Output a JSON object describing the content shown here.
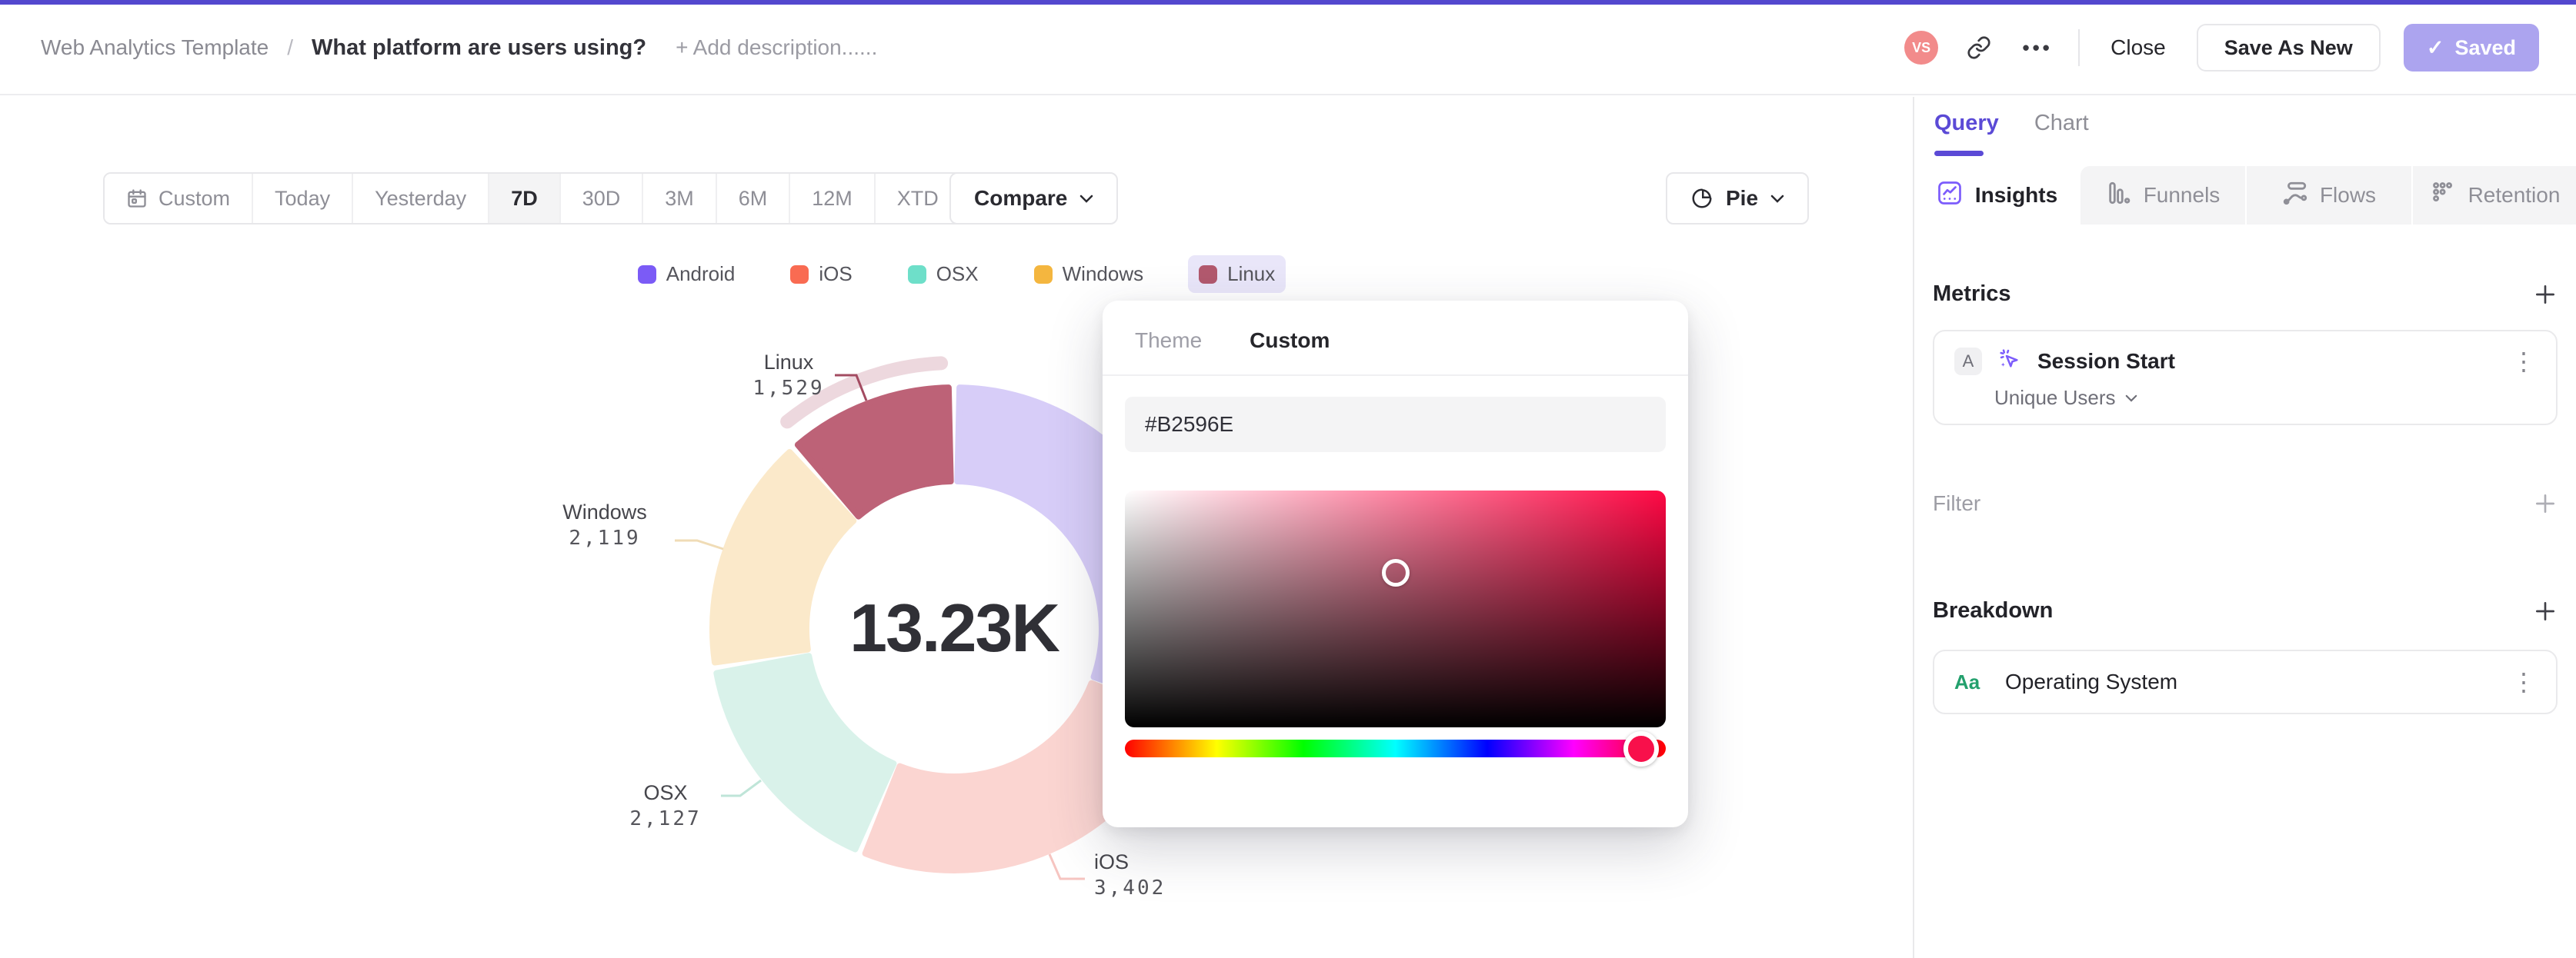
{
  "topbar": {
    "breadcrumb_root": "Web Analytics Template",
    "separator": "/",
    "title": "What platform are users using?",
    "add_description": "+ Add description......",
    "avatar_initials": "VS",
    "close_label": "Close",
    "save_as_new_label": "Save As New",
    "saved_label": "Saved",
    "accent_color": "#5348ce",
    "avatar_color": "#f28b8b",
    "saved_button_color": "#aca4ef"
  },
  "toolbar": {
    "ranges": [
      {
        "label": "Custom",
        "active": false
      },
      {
        "label": "Today",
        "active": false
      },
      {
        "label": "Yesterday",
        "active": false
      },
      {
        "label": "7D",
        "active": true
      },
      {
        "label": "30D",
        "active": false
      },
      {
        "label": "3M",
        "active": false
      },
      {
        "label": "6M",
        "active": false
      },
      {
        "label": "12M",
        "active": false
      },
      {
        "label": "XTD",
        "active": false
      }
    ],
    "compare_label": "Compare",
    "chart_type_label": "Pie"
  },
  "legend": {
    "items": [
      {
        "label": "Android",
        "color": "#7b5bf6",
        "selected": false
      },
      {
        "label": "iOS",
        "color": "#f96b52",
        "selected": false
      },
      {
        "label": "OSX",
        "color": "#6edfc9",
        "selected": false
      },
      {
        "label": "Windows",
        "color": "#f4b63f",
        "selected": false
      },
      {
        "label": "Linux",
        "color": "#b2596e",
        "selected": true
      }
    ],
    "selected_bg": "#e9e6f9"
  },
  "chart_data": {
    "type": "pie",
    "center_total": "13.23K",
    "categories": [
      "Android",
      "iOS",
      "OSX",
      "Windows",
      "Linux"
    ],
    "values": [
      4053,
      3402,
      2127,
      2119,
      1529
    ],
    "value_labels": [
      "",
      "3,402",
      "2,127",
      "2,119",
      "1,529"
    ],
    "slice_colors": [
      "#d7cdf8",
      "#fbd5d1",
      "#d9f2ea",
      "#fbe9ca",
      "#bd6277"
    ],
    "leader_colors": [
      "",
      "#f6c5c1",
      "#bfe5d8",
      "#f0dcb6",
      "#a34b61"
    ],
    "selected_slice": "Linux",
    "selected_index": 4,
    "highlight_color": "#edd8de",
    "slice_labels": {
      "linux": {
        "name": "Linux",
        "value": "1,529"
      },
      "windows": {
        "name": "Windows",
        "value": "2,119"
      },
      "osx": {
        "name": "OSX",
        "value": "2,127"
      },
      "ios": {
        "name": "iOS",
        "value": "3,402"
      }
    }
  },
  "color_picker": {
    "tabs": [
      "Theme",
      "Custom"
    ],
    "active_tab": "Custom",
    "hex_value": "#B2596E",
    "gradient_hue_hex": "#ff0844",
    "hue_handle_color": "#f8104b",
    "hue_position_pct": 95.4,
    "cursor_x_pct": 50,
    "cursor_y_pct": 34.7
  },
  "sidebar": {
    "tabs": [
      {
        "label": "Query",
        "active": true
      },
      {
        "label": "Chart",
        "active": false
      }
    ],
    "view_tabs": [
      {
        "label": "Insights",
        "active": true
      },
      {
        "label": "Funnels",
        "active": false
      },
      {
        "label": "Flows",
        "active": false
      },
      {
        "label": "Retention",
        "active": false
      }
    ],
    "metrics": {
      "header": "Metrics",
      "series_badge": "A",
      "event_name": "Session Start",
      "aggregation": "Unique Users"
    },
    "filter": {
      "header": "Filter"
    },
    "breakdown": {
      "header": "Breakdown",
      "item_badge": "Aa",
      "item_label": "Operating System"
    }
  }
}
